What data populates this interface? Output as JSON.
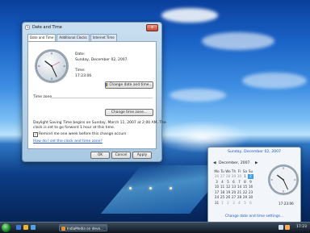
{
  "dialog": {
    "title": "Date and Time",
    "tabs": [
      "Date and Time",
      "Additional Clocks",
      "Internet Time"
    ],
    "date_label": "Date:",
    "date_value": "Sunday, December 02, 2007",
    "time_label": "Time:",
    "time_value": "17:23:06",
    "change_datetime_button": "Change date and time...",
    "timezone_label": "Time zone",
    "change_timezone_button": "Change time zone...",
    "dst_text_line1": "Daylight Saving Time begins on Sunday, March 11, 2007 at 2:00 AM. The",
    "dst_text_line2": "clock is set to go forward 1 hour at this time.",
    "remind_label": "Remind me one week before this change occurs",
    "remind_checked": true,
    "help_link": "How do I set the clock and time zone?",
    "ok": "OK",
    "cancel": "Cancel",
    "apply": "Apply",
    "close_glyph": "x"
  },
  "taskbar": {
    "task_label": "IndiaMedia on deve...",
    "tray_time": "17:23"
  },
  "flyout": {
    "header": "Sunday, December 02, 2007",
    "month": "December, 2007",
    "prev": "◀",
    "next": "▶",
    "weekdays": [
      "Mo",
      "Tu",
      "We",
      "Th",
      "Fr",
      "Sa",
      "Su"
    ],
    "weeks": [
      [
        "26",
        "27",
        "28",
        "29",
        "30",
        "1",
        "2"
      ],
      [
        "3",
        "4",
        "5",
        "6",
        "7",
        "8",
        "9"
      ],
      [
        "10",
        "11",
        "12",
        "13",
        "14",
        "15",
        "16"
      ],
      [
        "17",
        "18",
        "19",
        "20",
        "21",
        "22",
        "23"
      ],
      [
        "24",
        "25",
        "26",
        "27",
        "28",
        "29",
        "30"
      ],
      [
        "31",
        "1",
        "2",
        "3",
        "4",
        "5",
        "6"
      ]
    ],
    "selected_day": "2",
    "time": "17:23:06",
    "link": "Change date and time settings..."
  },
  "colors": {
    "accent": "#1b55c4",
    "selected_day": "#3ca0e8"
  }
}
